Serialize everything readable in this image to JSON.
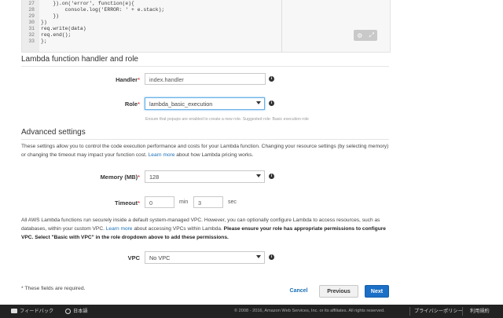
{
  "code": {
    "lines": [
      {
        "n": "27",
        "text": "    }).on('error', function(e){"
      },
      {
        "n": "28",
        "text": "        console.log('ERROR: ' + e.stack);"
      },
      {
        "n": "29",
        "text": "    })"
      },
      {
        "n": "30",
        "text": "})"
      },
      {
        "n": "31",
        "text": "req.write(data)"
      },
      {
        "n": "32",
        "text": "req.end();"
      },
      {
        "n": "33",
        "text": "};"
      }
    ]
  },
  "handler_section": {
    "title": "Lambda function handler and role",
    "handler_label": "Handler",
    "handler_value": "index.handler",
    "role_label": "Role",
    "role_value": "lambda_basic_execution",
    "role_hint": "Ensure that popups are enabled to create a new role. Suggested role: Basic execution role"
  },
  "advanced": {
    "title": "Advanced settings",
    "desc_pre": "These settings allow you to control the code execution performance and costs for your Lambda function. Changing your resource settings (by selecting memory) or changing the timeout may impact your function cost. ",
    "desc_link": "Learn more",
    "desc_post": " about how Lambda pricing works.",
    "memory_label": "Memory (MB)",
    "memory_value": "128",
    "timeout_label": "Timeout",
    "timeout_min": "0",
    "min_unit": "min",
    "timeout_sec": "3",
    "sec_unit": "sec",
    "vpc_pre": "All AWS Lambda functions run securely inside a default system-managed VPC. However, you can optionally configure Lambda to access resources, such as databases, within your custom VPC. ",
    "vpc_link": "Learn more",
    "vpc_mid": " about accessing VPCs within Lambda. ",
    "vpc_bold": "Please ensure your role has appropriate permissions to configure VPC. Select \"Basic with VPC\" in the role dropdown above to add these permissions.",
    "vpc_label": "VPC",
    "vpc_value": "No VPC"
  },
  "required_note": "* These fields are required.",
  "required_mark": "*",
  "buttons": {
    "cancel": "Cancel",
    "previous": "Previous",
    "next": "Next"
  },
  "footer": {
    "feedback": "フィードバック",
    "language": "日本語",
    "copyright": "© 2008 - 2016, Amazon Web Services, Inc. or its affiliates. All rights reserved.",
    "privacy": "プライバシーポリシー",
    "terms": "利用規約"
  },
  "colors": {
    "accent": "#1b6fc6",
    "link": "#1a6fb5",
    "footer_bg": "#222222"
  }
}
